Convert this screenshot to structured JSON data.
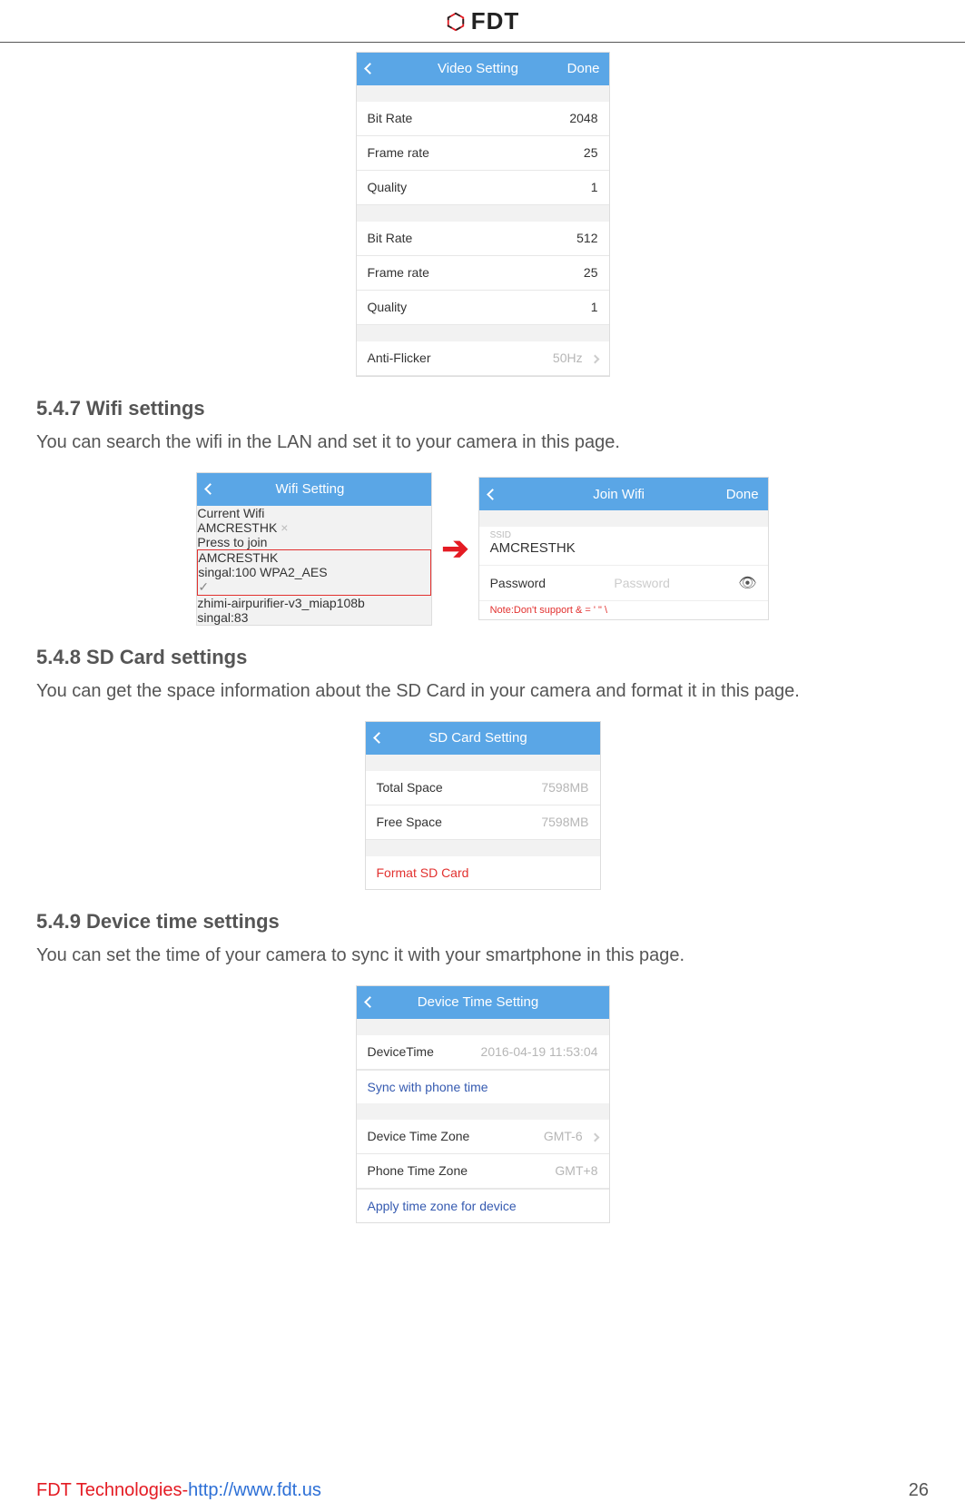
{
  "header": {
    "brand": "FDT"
  },
  "video": {
    "title": "Video Setting",
    "done": "Done",
    "group1": [
      {
        "label": "Bit Rate",
        "value": "2048"
      },
      {
        "label": "Frame rate",
        "value": "25"
      },
      {
        "label": "Quality",
        "value": "1"
      }
    ],
    "group2": [
      {
        "label": "Bit Rate",
        "value": "512"
      },
      {
        "label": "Frame rate",
        "value": "25"
      },
      {
        "label": "Quality",
        "value": "1"
      }
    ],
    "anti_label": "Anti-Flicker",
    "anti_value": "50Hz"
  },
  "s547": {
    "heading": "5.4.7 Wifi settings",
    "body": "You can search the wifi in the LAN and set it to your camera in this page."
  },
  "wifi_left": {
    "title": "Wifi Setting",
    "current_hdr": "Current Wifi",
    "current_ssid": "AMCRESTHK",
    "pick_hdr": "Press to join",
    "net1_ssid": "AMCRESTHK",
    "net1_sub": "singal:100   WPA2_AES",
    "net2_ssid": "zhimi-airpurifier-v3_miap108b",
    "net2_sub": "singal:83"
  },
  "wifi_right": {
    "title": "Join Wifi",
    "done": "Done",
    "ssid_lbl": "SSID",
    "ssid_val": "AMCRESTHK",
    "pw_lbl": "Password",
    "pw_ph": "Password",
    "note": "Note:Don't support & = ' \" \\"
  },
  "s548": {
    "heading": "5.4.8 SD Card settings",
    "body": "You can get the space information about the SD Card in your camera and format it in this page."
  },
  "sd": {
    "title": "SD Card Setting",
    "total_lbl": "Total Space",
    "total_val": "7598MB",
    "free_lbl": "Free Space",
    "free_val": "7598MB",
    "format": "Format SD Card"
  },
  "s549": {
    "heading": "5.4.9 Device time settings",
    "body": "You can set the time of your camera to sync it with your smartphone in this page."
  },
  "time": {
    "title": "Device Time Setting",
    "devtime_lbl": "DeviceTime",
    "devtime_val": "2016-04-19  11:53:04",
    "sync": "Sync with phone time",
    "dtz_lbl": "Device Time Zone",
    "dtz_val": "GMT-6",
    "ptz_lbl": "Phone Time Zone",
    "ptz_val": "GMT+8",
    "apply": "Apply time zone for device"
  },
  "footer": {
    "company": "FDT Technologies-",
    "url": "http://www.fdt.us",
    "page": "26"
  }
}
